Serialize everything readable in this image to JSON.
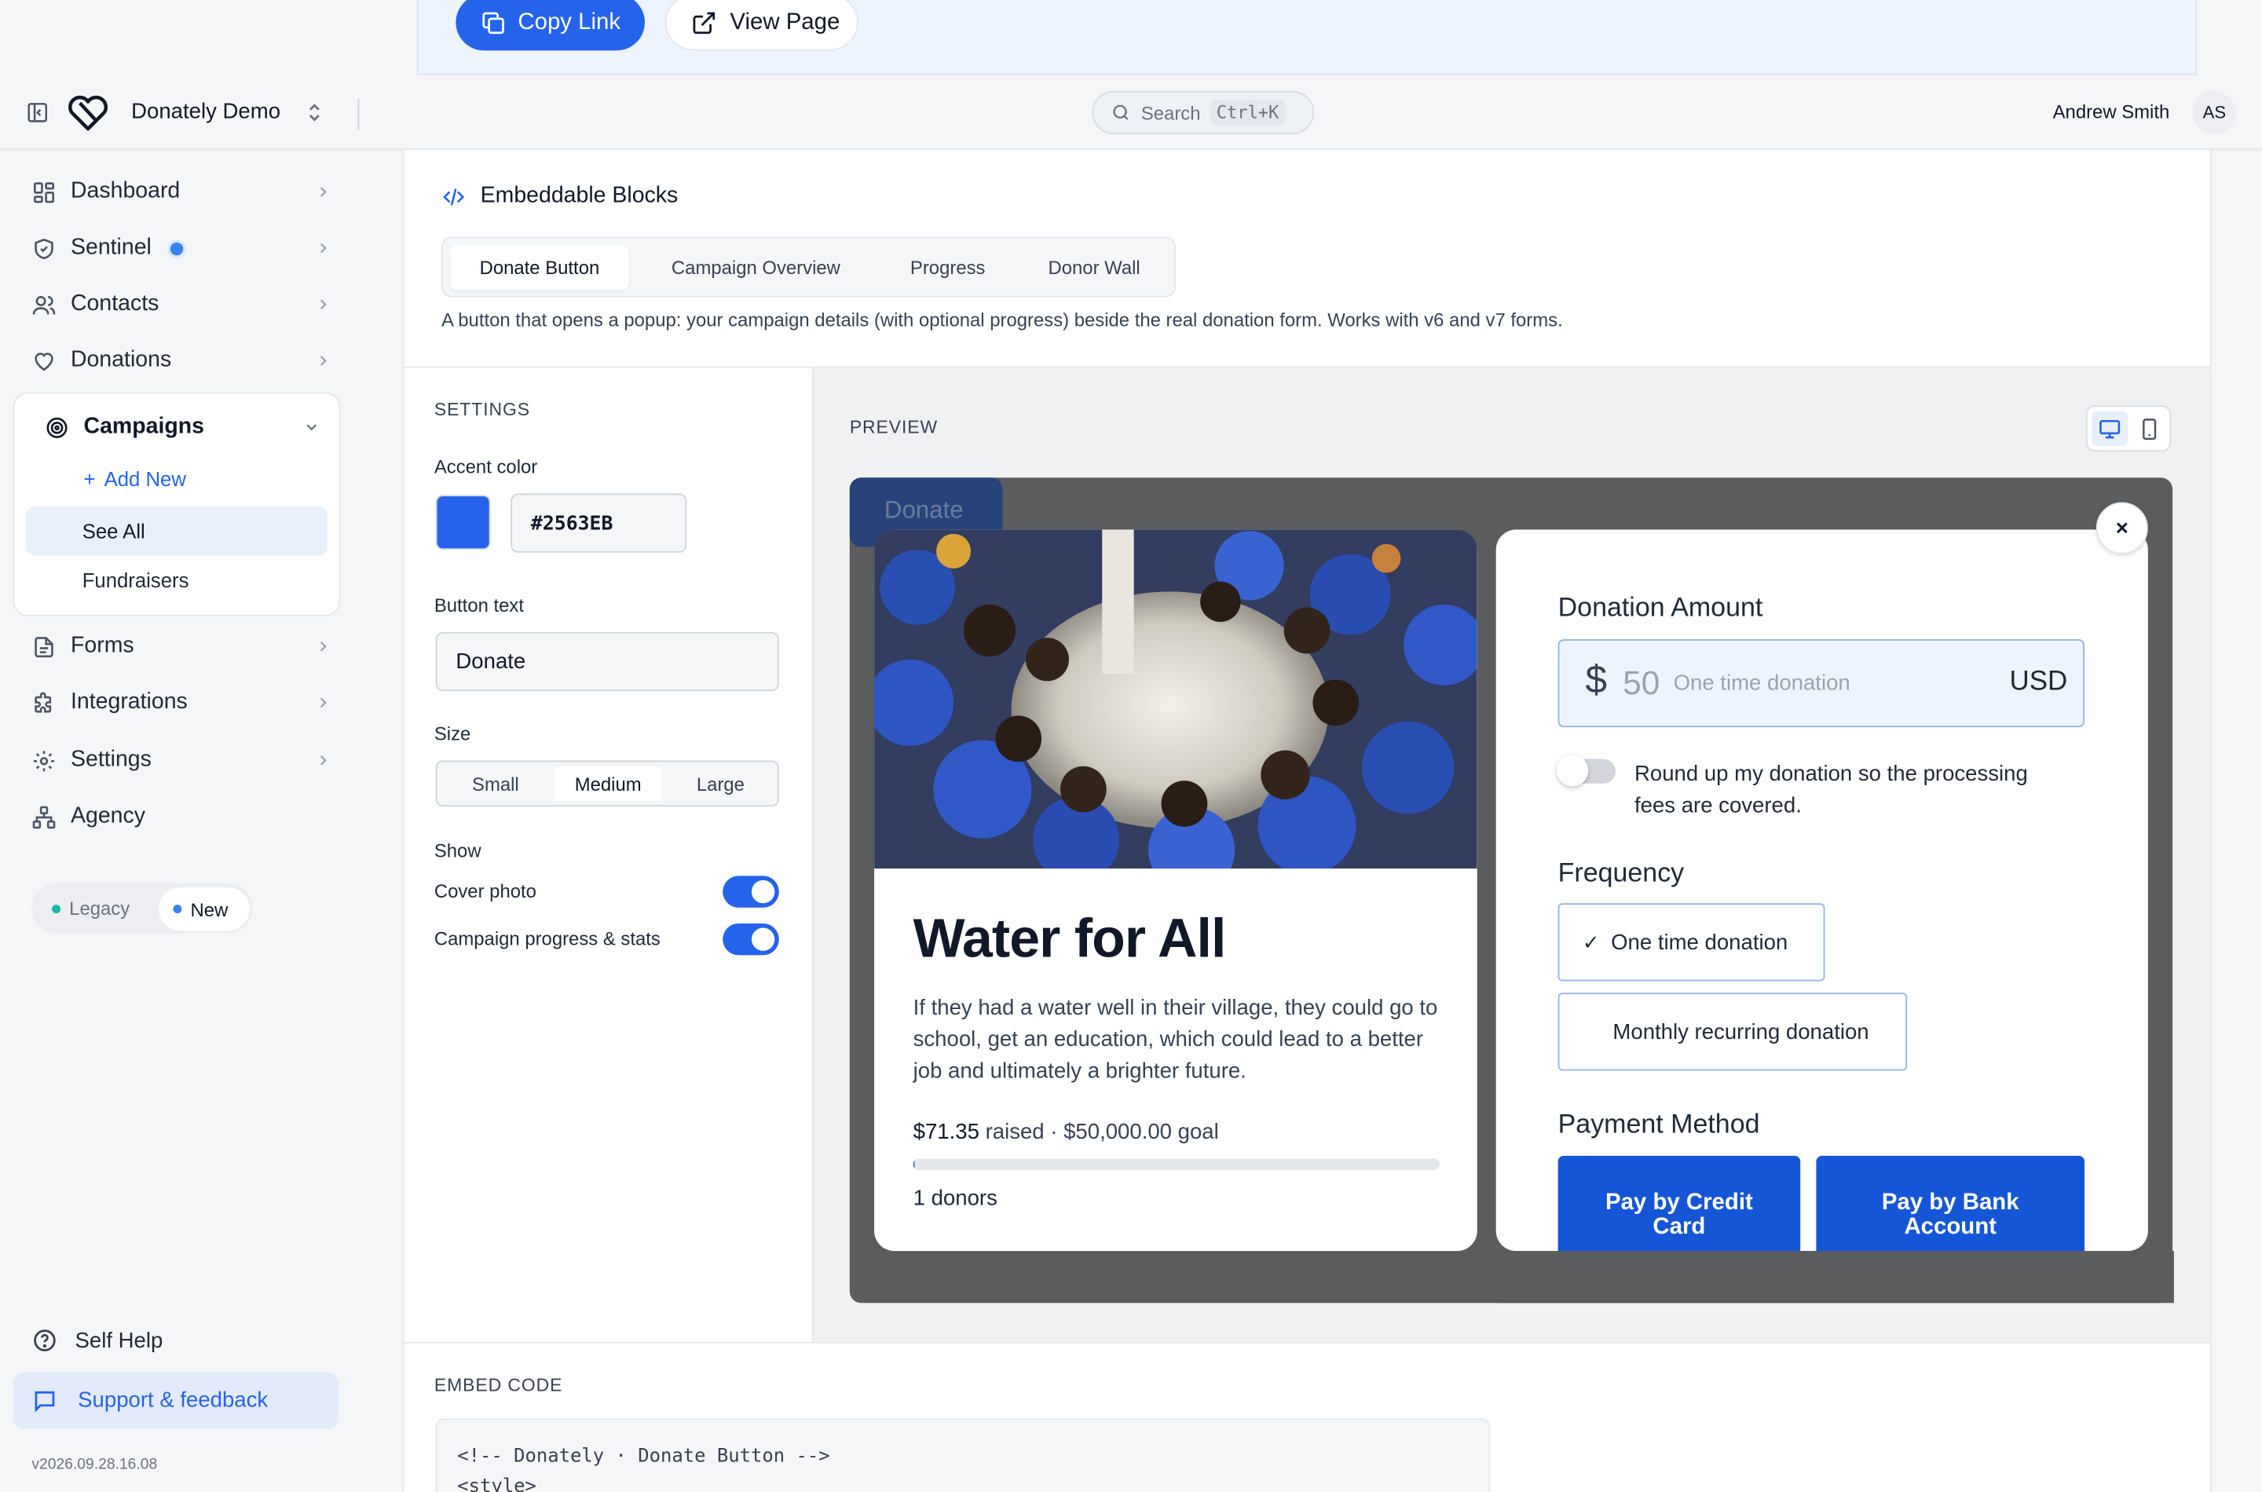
{
  "notice": {
    "copy_link": "Copy Link",
    "view_page": "View Page"
  },
  "header": {
    "org_name": "Donately Demo",
    "search_label": "Search",
    "search_shortcut": "Ctrl+K",
    "user_name": "Andrew Smith",
    "user_initials": "AS"
  },
  "sidebar": {
    "items": [
      {
        "label": "Dashboard",
        "icon": "dashboard-icon"
      },
      {
        "label": "Sentinel",
        "icon": "shield-icon"
      },
      {
        "label": "Contacts",
        "icon": "users-icon"
      },
      {
        "label": "Donations",
        "icon": "heart-icon"
      },
      {
        "label": "Campaigns",
        "icon": "target-icon"
      },
      {
        "label": "Forms",
        "icon": "file-icon"
      },
      {
        "label": "Integrations",
        "icon": "puzzle-icon"
      },
      {
        "label": "Settings",
        "icon": "gear-icon"
      },
      {
        "label": "Agency",
        "icon": "org-chart-icon"
      }
    ],
    "campaigns_sub": {
      "add_new": "Add New",
      "see_all": "See All",
      "fundraisers": "Fundraisers"
    },
    "mode": {
      "legacy": "Legacy",
      "new": "New"
    },
    "self_help": "Self Help",
    "support": "Support & feedback",
    "version": "v2026.09.28.16.08"
  },
  "main": {
    "title": "Embeddable Blocks",
    "tabs": [
      "Donate Button",
      "Campaign Overview",
      "Progress",
      "Donor Wall"
    ],
    "description": "A button that opens a popup: your campaign details (with optional progress) beside the real donation form. Works with v6 and v7 forms.",
    "settings": {
      "title": "SETTINGS",
      "accent_label": "Accent color",
      "accent_value": "#2563EB",
      "button_text_label": "Button text",
      "button_text_value": "Donate",
      "size_label": "Size",
      "sizes": [
        "Small",
        "Medium",
        "Large"
      ],
      "selected_size": "Medium",
      "show_label": "Show",
      "cover_photo_label": "Cover photo",
      "cover_photo_on": true,
      "progress_label": "Campaign progress & stats",
      "progress_on": true
    },
    "preview": {
      "title": "PREVIEW",
      "donate_button": "Donate",
      "close": "×",
      "campaign": {
        "title": "Water for All",
        "description": "If they had a water well in their village, they could go to school, get an education, which could lead to a better job and ultimately a brighter future.",
        "raised_amount": "$71.35",
        "raised_text": "raised · $50,000.00 goal",
        "progress_fraction": 0.0014,
        "donors": "1 donors"
      },
      "form": {
        "amount_title": "Donation Amount",
        "currency_symbol": "$",
        "amount_placeholder": "50",
        "amount_note": "One time donation",
        "currency_code": "USD",
        "roundup_text": "Round up my donation so the processing fees are covered.",
        "frequency_title": "Frequency",
        "frequency_options": [
          "One time donation",
          "Monthly recurring donation"
        ],
        "check": "✓",
        "payment_title": "Payment Method",
        "payment_options": [
          "Pay by Credit Card",
          "Pay by Bank Account"
        ]
      }
    },
    "embed": {
      "title": "EMBED CODE",
      "code_lines": [
        "<!-- Donately · Donate Button -->",
        "<style>"
      ]
    }
  },
  "colors": {
    "accent": "#2563EB",
    "link": "#2563eb",
    "pay_button": "#1556d6"
  }
}
